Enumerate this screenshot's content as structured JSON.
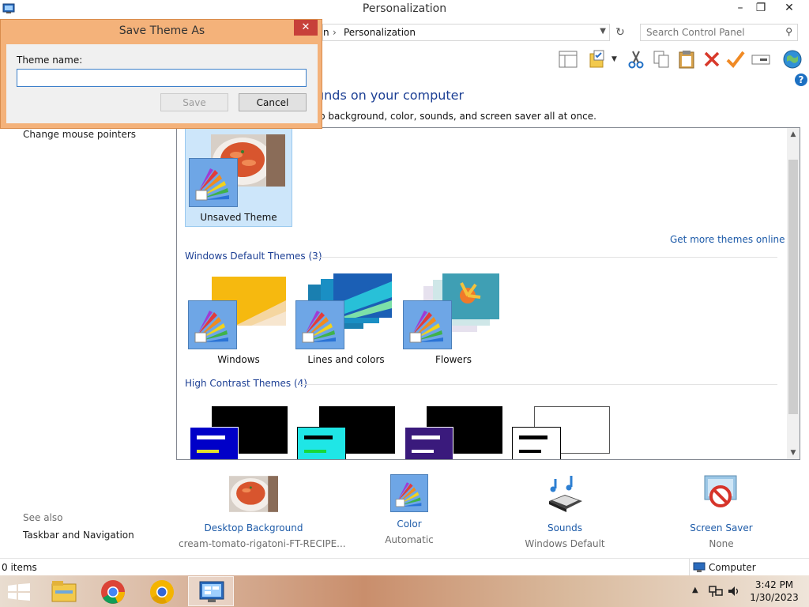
{
  "window": {
    "title": "Personalization",
    "minimize_glyph": "–",
    "restore_glyph": "❐",
    "close_glyph": "✕"
  },
  "address": {
    "breadcrumb_partial": "n",
    "separator": "›",
    "current": "Personalization",
    "search_placeholder": "Search Control Panel"
  },
  "main": {
    "heading": "unds on your computer",
    "subheading": "p background, color, sounds, and screen saver all at once."
  },
  "nav": {
    "change_mouse_pointers": "Change mouse pointers",
    "see_also": "See also",
    "taskbar_navigation": "Taskbar and Navigation"
  },
  "themes": {
    "my_themes": [
      {
        "label": "Unsaved Theme"
      }
    ],
    "get_more_link": "Get more themes online",
    "default_section": "Windows Default Themes (3)",
    "default_themes": [
      {
        "label": "Windows"
      },
      {
        "label": "Lines and colors"
      },
      {
        "label": "Flowers"
      }
    ],
    "high_contrast_section": "High Contrast Themes (4)"
  },
  "bottom": {
    "desktop_background": {
      "label": "Desktop Background",
      "value": "cream-tomato-rigatoni-FT-RECIPE..."
    },
    "color": {
      "label": "Color",
      "value": "Automatic"
    },
    "sounds": {
      "label": "Sounds",
      "value": "Windows Default"
    },
    "screen_saver": {
      "label": "Screen Saver",
      "value": "None"
    }
  },
  "status": {
    "items": "0 items",
    "zone": "Computer"
  },
  "taskbar": {
    "time": "3:42 PM",
    "date": "1/30/2023"
  },
  "dialog": {
    "title": "Save Theme As",
    "close_glyph": "✕",
    "field_label": "Theme name:",
    "field_value": "",
    "save_label": "Save",
    "cancel_label": "Cancel"
  },
  "colors": {
    "link_blue": "#1c5aa8",
    "heading_blue": "#1c3f94",
    "dialog_frame": "#f4b27a",
    "close_red": "#c7403a",
    "selection": "#cde6fa"
  }
}
